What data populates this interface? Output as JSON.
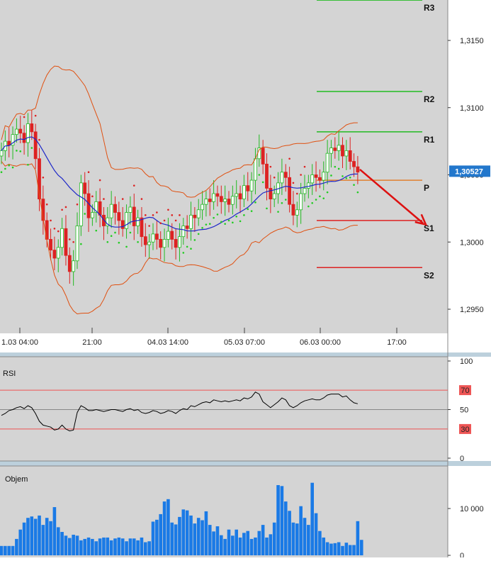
{
  "colors": {
    "bg": "#d4d4d4",
    "axis_bg": "#ffffff",
    "separator": "#bcd0dc",
    "bull": "#22bb22",
    "bear": "#dd2222",
    "bollinger": "#e05010",
    "ma": "#1e28c8",
    "sar_up": "#22cc22",
    "sar_down": "#dd2222",
    "r_lines": "#22bb22",
    "s_lines": "#dd2222",
    "p_line": "#e08030",
    "arrow": "#dd1111",
    "price_tag": "#2277cc",
    "rsi_line": "#000000",
    "rsi_level": "#ee5555",
    "volume_bar": "#1a7ae6"
  },
  "chart_data": [
    {
      "type": "candlestick",
      "ylim": [
        1.2925,
        1.3185
      ],
      "y_ticks": [
        1.295,
        1.3,
        1.305,
        1.31,
        1.315
      ],
      "y_tick_labels": [
        "1,2950",
        "1,3000",
        "1,3050",
        "1,3100",
        "1,3150"
      ],
      "x_tick_labels": [
        "1.03 04:00",
        "21:00",
        "04.03 14:00",
        "05.03 07:00",
        "06.03 00:00",
        "17:00"
      ],
      "last_price": 1.30527,
      "last_price_label": "1,30527",
      "pivots": [
        {
          "label": "R3",
          "value": 1.318
        },
        {
          "label": "R2",
          "value": 1.3112
        },
        {
          "label": "R1",
          "value": 1.3082
        },
        {
          "label": "P",
          "value": 1.3046
        },
        {
          "label": "S1",
          "value": 1.3016
        },
        {
          "label": "S2",
          "value": 1.2981
        }
      ],
      "forecast_arrow": {
        "from": 1.3054,
        "to": 1.3013
      },
      "closes": [
        1.3068,
        1.3075,
        1.3072,
        1.308,
        1.3084,
        1.3081,
        1.3074,
        1.3088,
        1.3082,
        1.3062,
        1.3032,
        1.3016,
        1.3002,
        1.2994,
        1.2988,
        1.2996,
        1.301,
        1.299,
        1.2978,
        1.2986,
        1.3012,
        1.3044,
        1.3036,
        1.3018,
        1.3022,
        1.303,
        1.302,
        1.3012,
        1.3018,
        1.3028,
        1.3022,
        1.3016,
        1.301,
        1.3022,
        1.3026,
        1.3012,
        1.3018,
        1.3004,
        1.2998,
        1.3,
        1.3006,
        1.3002,
        1.2996,
        1.3002,
        1.3008,
        1.3002,
        1.2996,
        1.3004,
        1.3012,
        1.301,
        1.302,
        1.3018,
        1.3024,
        1.3028,
        1.3032,
        1.303,
        1.3036,
        1.3034,
        1.303,
        1.3032,
        1.3028,
        1.3034,
        1.3036,
        1.3032,
        1.3042,
        1.3038,
        1.3046,
        1.3062,
        1.307,
        1.3058,
        1.304,
        1.3032,
        1.3036,
        1.3044,
        1.3052,
        1.3048,
        1.3028,
        1.302,
        1.3024,
        1.3036,
        1.304,
        1.3044,
        1.305,
        1.3048,
        1.3046,
        1.3052,
        1.3066,
        1.307,
        1.3068,
        1.3072,
        1.3064,
        1.3068,
        1.306,
        1.3056,
        1.3052
      ]
    },
    {
      "type": "line",
      "name": "RSI",
      "ylim": [
        0,
        100
      ],
      "levels": [
        70,
        30
      ],
      "level_labels": [
        "70",
        "30"
      ],
      "y_tick_labels": [
        "100",
        "50",
        "0"
      ],
      "values": [
        44,
        46,
        49,
        50,
        52,
        53,
        51,
        54,
        52,
        46,
        38,
        34,
        33,
        32,
        29,
        30,
        34,
        30,
        28,
        29,
        47,
        54,
        52,
        49,
        49,
        50,
        49,
        48,
        49,
        50,
        50,
        49,
        48,
        50,
        51,
        49,
        50,
        47,
        46,
        47,
        49,
        48,
        46,
        47,
        49,
        48,
        46,
        49,
        51,
        50,
        54,
        53,
        55,
        57,
        58,
        57,
        60,
        59,
        58,
        59,
        58,
        59,
        60,
        59,
        62,
        61,
        63,
        68,
        66,
        58,
        55,
        52,
        55,
        58,
        62,
        60,
        54,
        52,
        54,
        57,
        59,
        60,
        61,
        60,
        60,
        62,
        65,
        66,
        66,
        66,
        63,
        64,
        60,
        57,
        56
      ]
    },
    {
      "type": "bar",
      "name": "Objem",
      "ylim": [
        0,
        17000
      ],
      "y_ticks": [
        0,
        10000
      ],
      "y_tick_labels": [
        "0",
        "10 000"
      ],
      "values": [
        2000,
        2000,
        2000,
        2000,
        3500,
        5500,
        7000,
        8000,
        8300,
        7800,
        8500,
        6500,
        8000,
        7300,
        10300,
        6000,
        5000,
        4200,
        3700,
        4400,
        4200,
        3200,
        3500,
        3800,
        3500,
        3000,
        3600,
        3800,
        3800,
        3200,
        3600,
        3800,
        3600,
        3000,
        3600,
        3600,
        3200,
        3800,
        2800,
        3000,
        7200,
        7600,
        8800,
        11500,
        12000,
        7000,
        6600,
        8200,
        9800,
        9600,
        8500,
        6800,
        8000,
        7500,
        9400,
        6500,
        5100,
        6200,
        4300,
        3500,
        5500,
        4200,
        5500,
        3800,
        4800,
        5200,
        3500,
        3800,
        5200,
        6500,
        3800,
        4500,
        7000,
        15000,
        14800,
        11500,
        9500,
        7000,
        6800,
        10500,
        8000,
        6500,
        15500,
        9000,
        5200,
        3800,
        2800,
        2500,
        2600,
        2800,
        2000,
        2700,
        2200,
        2200,
        7300,
        3300
      ]
    }
  ],
  "panels": {
    "rsi_title": "RSI",
    "volume_title": "Objem"
  }
}
